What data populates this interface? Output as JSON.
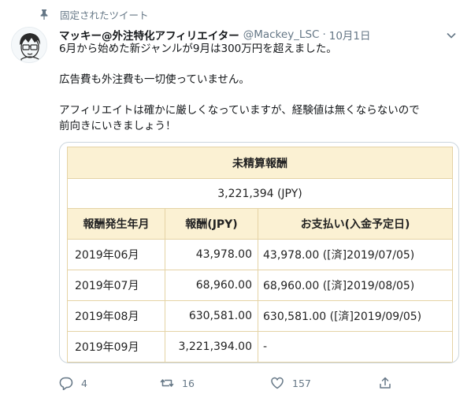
{
  "pinned_label": "固定されたツイート",
  "author": {
    "name": "マッキー@外注特化アフィリエイター",
    "handle": "@Mackey_LSC",
    "separator": "·",
    "date": "10月1日"
  },
  "tweet": {
    "line1": "6月から始めた新ジャンルが9月は300万円を超えました。",
    "line2": "広告費も外注費も一切使っていません。",
    "line3": "アフィリエイトは確かに厳しくなっていますが、経験値は無くならないので",
    "line4": "前向きにいきましょう！"
  },
  "rewards_table": {
    "title": "未精算報酬",
    "total": "3,221,394 (JPY)",
    "headers": [
      "報酬発生年月",
      "報酬(JPY)",
      "お支払い(入金予定日)"
    ],
    "rows": [
      {
        "month": "2019年06月",
        "amount": "43,978.00",
        "payment": "43,978.00 ([済]2019/07/05)"
      },
      {
        "month": "2019年07月",
        "amount": "68,960.00",
        "payment": "68,960.00 ([済]2019/08/05)"
      },
      {
        "month": "2019年08月",
        "amount": "630,581.00",
        "payment": "630,581.00 ([済]2019/09/05)"
      },
      {
        "month": "2019年09月",
        "amount": "3,221,394.00",
        "payment": "-"
      }
    ]
  },
  "actions": {
    "reply_count": "4",
    "retweet_count": "16",
    "like_count": "157"
  },
  "colors": {
    "table_header_bg": "#fbf1d3",
    "table_border": "#e5d3a5",
    "muted_text": "#657786"
  },
  "icons": [
    "pin-icon",
    "avatar",
    "chevron-down-icon",
    "reply-icon",
    "retweet-icon",
    "like-icon",
    "share-icon"
  ]
}
